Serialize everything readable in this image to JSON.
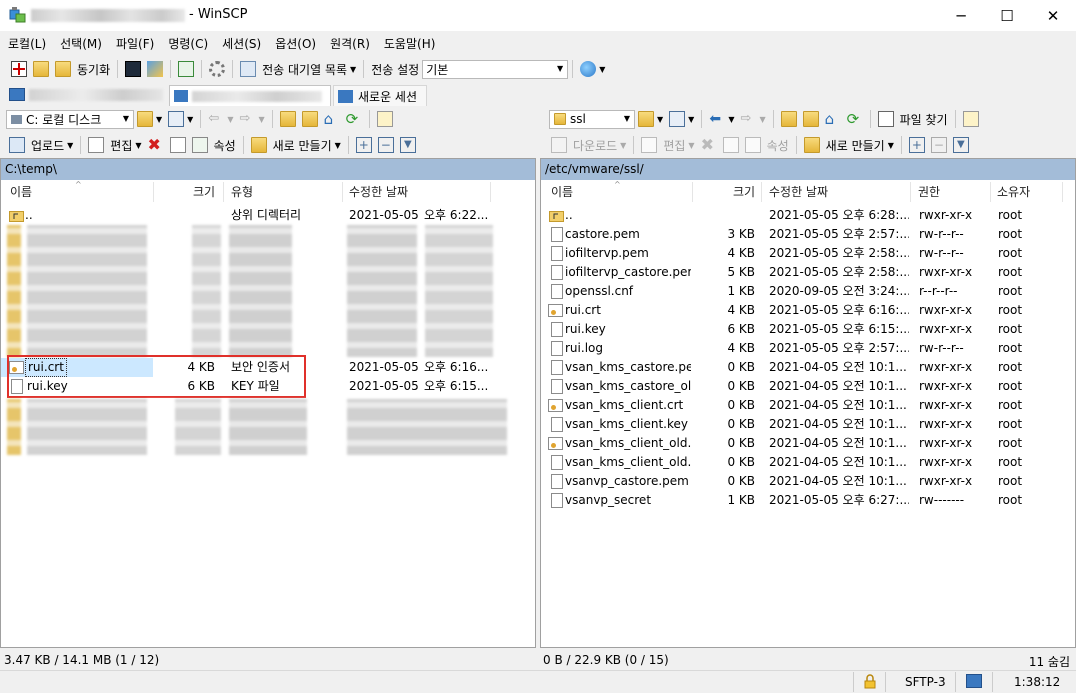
{
  "window": {
    "title": "- WinSCP",
    "minimize": "─",
    "maximize": "☐",
    "close": "✕"
  },
  "menu": [
    "로컬(L)",
    "선택(M)",
    "파일(F)",
    "명령(C)",
    "세션(S)",
    "옵션(O)",
    "원격(R)",
    "도움말(H)"
  ],
  "toolbar": {
    "sync_label": "동기화",
    "transfer_queue_label": "전송 대기열 목록",
    "transfer_settings_label": "전송 설정",
    "transfer_preset": "기본"
  },
  "tabs": {
    "new_session": "새로운 세션"
  },
  "local": {
    "drive": "C: 로컬 디스크",
    "upload_label": "업로드",
    "edit_label": "편집",
    "properties_label": "속성",
    "new_label": "새로 만들기",
    "path": "C:\\temp\\",
    "headers": {
      "name": "이름",
      "size": "크기",
      "type": "유형",
      "modified": "수정한 날짜"
    },
    "parent_row": {
      "name": "..",
      "type": "상위 디렉터리",
      "date": "2021-05-05",
      "time": "오후 6:22..."
    },
    "files": [
      {
        "name": "rui.crt",
        "size": "4 KB",
        "type": "보안 인증서",
        "date": "2021-05-05",
        "time": "오후 6:16..."
      },
      {
        "name": "rui.key",
        "size": "6 KB",
        "type": "KEY 파일",
        "date": "2021-05-05",
        "time": "오후 6:15..."
      }
    ],
    "status": "3.47 KB / 14.1 MB (1 / 12)"
  },
  "remote": {
    "dir_combo": "ssl",
    "search_label": "파일 찾기",
    "download_label": "다운로드",
    "edit_label": "편집",
    "properties_label": "속성",
    "new_label": "새로 만들기",
    "path": "/etc/vmware/ssl/",
    "headers": {
      "name": "이름",
      "size": "크기",
      "modified": "수정한 날짜",
      "rights": "권한",
      "owner": "소유자"
    },
    "files": [
      {
        "name": "..",
        "size": "",
        "modified": "2021-05-05 오후 6:28:...",
        "rights": "rwxr-xr-x",
        "owner": "root",
        "icon": "up"
      },
      {
        "name": "castore.pem",
        "size": "3 KB",
        "modified": "2021-05-05 오후 2:57:...",
        "rights": "rw-r--r--",
        "owner": "root",
        "icon": "file"
      },
      {
        "name": "iofiltervp.pem",
        "size": "4 KB",
        "modified": "2021-05-05 오후 2:58:...",
        "rights": "rw-r--r--",
        "owner": "root",
        "icon": "file"
      },
      {
        "name": "iofiltervp_castore.pem",
        "size": "5 KB",
        "modified": "2021-05-05 오후 2:58:...",
        "rights": "rwxr-xr-x",
        "owner": "root",
        "icon": "file"
      },
      {
        "name": "openssl.cnf",
        "size": "1 KB",
        "modified": "2020-09-05 오전 3:24:...",
        "rights": "r--r--r--",
        "owner": "root",
        "icon": "file"
      },
      {
        "name": "rui.crt",
        "size": "4 KB",
        "modified": "2021-05-05 오후 6:16:...",
        "rights": "rwxr-xr-x",
        "owner": "root",
        "icon": "cert"
      },
      {
        "name": "rui.key",
        "size": "6 KB",
        "modified": "2021-05-05 오후 6:15:...",
        "rights": "rwxr-xr-x",
        "owner": "root",
        "icon": "file"
      },
      {
        "name": "rui.log",
        "size": "4 KB",
        "modified": "2021-05-05 오후 2:57:...",
        "rights": "rw-r--r--",
        "owner": "root",
        "icon": "file"
      },
      {
        "name": "vsan_kms_castore.pem",
        "size": "0 KB",
        "modified": "2021-04-05 오전 10:1...",
        "rights": "rwxr-xr-x",
        "owner": "root",
        "icon": "file"
      },
      {
        "name": "vsan_kms_castore_ol...",
        "size": "0 KB",
        "modified": "2021-04-05 오전 10:1...",
        "rights": "rwxr-xr-x",
        "owner": "root",
        "icon": "file"
      },
      {
        "name": "vsan_kms_client.crt",
        "size": "0 KB",
        "modified": "2021-04-05 오전 10:1...",
        "rights": "rwxr-xr-x",
        "owner": "root",
        "icon": "cert"
      },
      {
        "name": "vsan_kms_client.key",
        "size": "0 KB",
        "modified": "2021-04-05 오전 10:1...",
        "rights": "rwxr-xr-x",
        "owner": "root",
        "icon": "file"
      },
      {
        "name": "vsan_kms_client_old.crt",
        "size": "0 KB",
        "modified": "2021-04-05 오전 10:1...",
        "rights": "rwxr-xr-x",
        "owner": "root",
        "icon": "cert"
      },
      {
        "name": "vsan_kms_client_old....",
        "size": "0 KB",
        "modified": "2021-04-05 오전 10:1...",
        "rights": "rwxr-xr-x",
        "owner": "root",
        "icon": "file"
      },
      {
        "name": "vsanvp_castore.pem",
        "size": "0 KB",
        "modified": "2021-04-05 오전 10:1...",
        "rights": "rwxr-xr-x",
        "owner": "root",
        "icon": "file"
      },
      {
        "name": "vsanvp_secret",
        "size": "1 KB",
        "modified": "2021-05-05 오후 6:27:...",
        "rights": "rw-------",
        "owner": "root",
        "icon": "file"
      }
    ],
    "status": "0 B / 22.9 KB (0 / 15)",
    "hidden": "11 숨김"
  },
  "statusbar": {
    "protocol": "SFTP-3",
    "elapsed": "1:38:12"
  },
  "colors": {
    "path_bar": "#a3bcd8",
    "selection": "#cce8ff",
    "highlight_box": "#e0302a"
  }
}
